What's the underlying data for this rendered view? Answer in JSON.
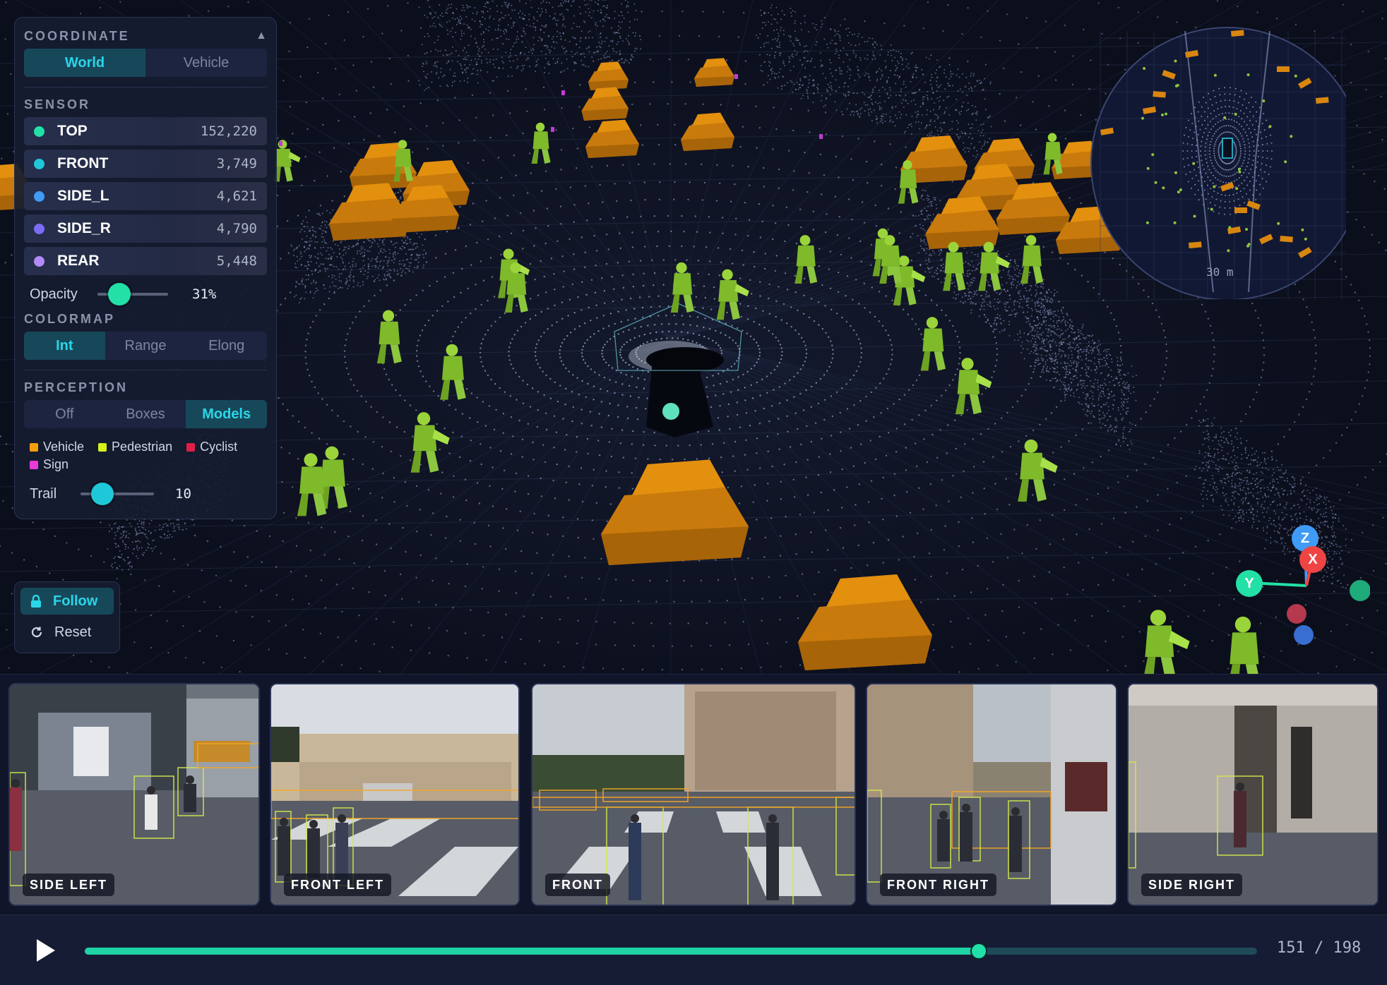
{
  "panel": {
    "coordinate": {
      "title": "COORDINATE",
      "options": [
        "World",
        "Vehicle"
      ],
      "active": 0
    },
    "sensor": {
      "title": "SENSOR",
      "items": [
        {
          "name": "TOP",
          "count": "152,220",
          "color": "#22e0a6"
        },
        {
          "name": "FRONT",
          "count": "3,749",
          "color": "#1fc8d8"
        },
        {
          "name": "SIDE_L",
          "count": "4,621",
          "color": "#3f9bf5"
        },
        {
          "name": "SIDE_R",
          "count": "4,790",
          "color": "#7b6cf4"
        },
        {
          "name": "REAR",
          "count": "5,448",
          "color": "#b38af7"
        }
      ]
    },
    "opacity": {
      "label": "Opacity",
      "value": "31%",
      "fraction": 0.31,
      "knob_color": "#22e0a6"
    },
    "colormap": {
      "title": "COLORMAP",
      "options": [
        "Int",
        "Range",
        "Elong"
      ],
      "active": 0
    },
    "perception": {
      "title": "PERCEPTION",
      "options": [
        "Off",
        "Boxes",
        "Models"
      ],
      "active": 2,
      "legend": [
        {
          "label": "Vehicle",
          "color": "#f59e0b"
        },
        {
          "label": "Pedestrian",
          "color": "#d4f21a"
        },
        {
          "label": "Cyclist",
          "color": "#e11d48"
        },
        {
          "label": "Sign",
          "color": "#e83ad8"
        }
      ]
    },
    "trail": {
      "label": "Trail",
      "value": "10",
      "fraction": 0.3,
      "knob_color": "#1fc8d8"
    }
  },
  "camera_controls": {
    "follow": "Follow",
    "reset": "Reset"
  },
  "minimap": {
    "scale_label": "30 m"
  },
  "gizmo": {
    "z": "Z",
    "x": "X",
    "y": "Y"
  },
  "cameras": [
    "SIDE LEFT",
    "FRONT LEFT",
    "FRONT",
    "FRONT RIGHT",
    "SIDE RIGHT"
  ],
  "timeline": {
    "current": 151,
    "total": 198,
    "label": "151 / 198"
  },
  "colors": {
    "accent": "#22e0a6",
    "vehicle": "#d9860f",
    "pedestrian": "#8cc63f",
    "panel": "#161c30"
  }
}
